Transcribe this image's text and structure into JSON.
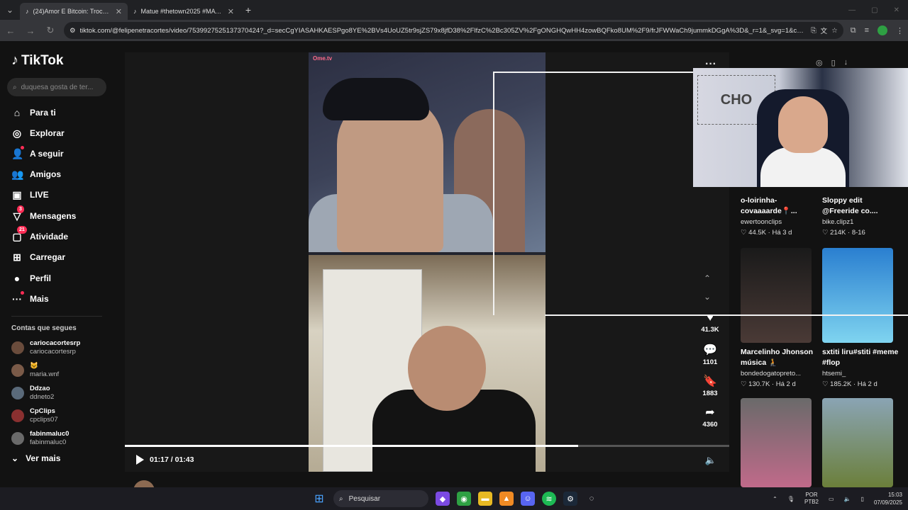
{
  "browser": {
    "tabs": [
      {
        "title": "(24)Amor E Bitcoin: Troca de N...",
        "active": true
      },
      {
        "title": "Matue #thetown2025 #MATUE",
        "active": false
      }
    ],
    "url": "tiktok.com/@felipenetracortes/video/7539927525137370424?_d=secCgYIASAHKAESPgo8YE%2BVs4UoUZ5tr9sjZS79x8jfD38%2FlfzC%2Bc305ZV%2FgONGHQwHH4zowBQFko8UM%2F9/frJFWWaCh9jummkDGgA%3D&_r=1&_svg=1&check..."
  },
  "sidebar": {
    "logo": "TikTok",
    "search_placeholder": "duquesa gosta de ter...",
    "menu": [
      {
        "label": "Para ti",
        "icon": "home-icon"
      },
      {
        "label": "Explorar",
        "icon": "compass-icon"
      },
      {
        "label": "A seguir",
        "icon": "following-icon"
      },
      {
        "label": "Amigos",
        "icon": "friends-icon"
      },
      {
        "label": "LIVE",
        "icon": "live-icon"
      },
      {
        "label": "Mensagens",
        "icon": "messages-icon",
        "badge": "3"
      },
      {
        "label": "Atividade",
        "icon": "activity-icon",
        "badge": "21"
      },
      {
        "label": "Carregar",
        "icon": "upload-icon"
      },
      {
        "label": "Perfil",
        "icon": "profile-icon"
      },
      {
        "label": "Mais",
        "icon": "more-icon"
      }
    ],
    "following_title": "Contas que segues",
    "following": [
      {
        "name": "cariocacortesrp",
        "handle": "cariocacortesrp"
      },
      {
        "name": "😺",
        "handle": "maria.wnf"
      },
      {
        "name": "Ddzao",
        "handle": "ddneto2"
      },
      {
        "name": "CpClips",
        "handle": "cpclips07"
      },
      {
        "name": "fabinmaluc0",
        "handle": "fabinmaluc0"
      }
    ],
    "see_more": "Ver mais"
  },
  "video": {
    "watermark": "Ome.tv",
    "time": "01:17 / 01:43",
    "progress": 0.75,
    "likes": "41.3K",
    "comments": "1101",
    "saves": "1883",
    "shares": "4360",
    "author": "felipenetracortes"
  },
  "recommendations": [
    {
      "title": "o-loirinha-covaaaarde📍...",
      "author": "ewertoonclips",
      "likes": "44.5K",
      "age": "Há 3 d"
    },
    {
      "title": "Sloppy edit @Freeride co....",
      "author": "bike.clipz1",
      "likes": "214K",
      "age": "8-16"
    },
    {
      "title": "Marcelinho Jhonson música 🧎",
      "author": "bondedogatopreto...",
      "likes": "130.7K",
      "age": "Há 2 d"
    },
    {
      "title": "sxtiti liru#stiti #meme #flop",
      "author": "htsemi_",
      "likes": "185.2K",
      "age": "Há 2 d"
    }
  ],
  "cam_overlay_art": "CHO",
  "taskbar": {
    "search": "Pesquisar",
    "lang": "POR",
    "lang2": "PTB2",
    "time": "15:03",
    "date": "07/09/2025"
  },
  "colors": {
    "accent": "#fe2c55",
    "background": "#121212"
  }
}
